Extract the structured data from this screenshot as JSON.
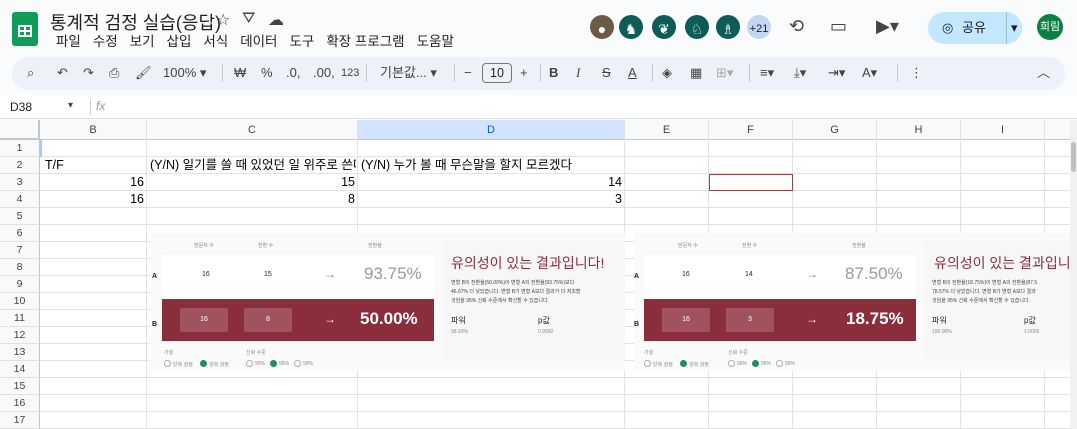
{
  "doc": {
    "title": "통계적 검정 실습(응답)"
  },
  "menu": [
    "파일",
    "수정",
    "보기",
    "삽입",
    "서식",
    "데이터",
    "도구",
    "확장 프로그램",
    "도움말"
  ],
  "collab": {
    "more": "+21"
  },
  "share": {
    "label": "공유"
  },
  "user": {
    "initials": "희림"
  },
  "toolbar": {
    "zoom": "100%",
    "currency": "₩",
    "percent": "%",
    "dec_less": ".0,",
    "dec_more": ".00,",
    "numfmt": "123",
    "font": "기본값...",
    "fontsize": "10"
  },
  "formula": {
    "cellref": "D38",
    "fx": "fx"
  },
  "columns": [
    "B",
    "C",
    "D",
    "E",
    "F",
    "G",
    "H",
    "I"
  ],
  "rows": [
    "1",
    "2",
    "3",
    "4",
    "5",
    "6",
    "7",
    "8",
    "9",
    "10",
    "11",
    "12",
    "13",
    "14",
    "15",
    "16",
    "17"
  ],
  "cells": {
    "b2": "T/F",
    "c2": "(Y/N) 일기를 쓸 때 있었던 일 위주로 쓴다",
    "d2": "(Y/N) 누가 볼 때 무슨말을 할지 모르겠다",
    "b3": "16",
    "c3": "15",
    "d3": "14",
    "b4": "16",
    "c4": "8",
    "d4": "3"
  },
  "panels": [
    {
      "hdr1": "방문자 수",
      "hdr2": "전환 수",
      "hdr3": "전환율",
      "a_label": "A",
      "a_v": "16",
      "a_c": "15",
      "a_rate": "93.75%",
      "b_label": "B",
      "b_v": "16",
      "b_c": "8",
      "b_rate": "50.00%",
      "arrow": "→",
      "opt1": "가설",
      "opt2": "신뢰 수준",
      "o1": "단측 검정",
      "o2": "양측 검정",
      "p1": "90%",
      "p2": "95%",
      "p3": "99%",
      "result": "유의성이 있는 결과입니다!",
      "desc1": "변형 B의 전환율(50.00%)이 변형 A의 전환율(93.75%)보다",
      "desc2": "46.67% 더 낮았습니다. 변형 B가 변형 A보다 결과가 더 저조할",
      "desc3": "것임을 95% 신뢰 수준에서 확신할 수 있습니다.",
      "power_label": "파워",
      "power": "98.93%",
      "p_label": "p값",
      "p": "0.9992"
    },
    {
      "hdr1": "방문자 수",
      "hdr2": "전환 수",
      "hdr3": "전환율",
      "a_label": "A",
      "a_v": "16",
      "a_c": "14",
      "a_rate": "87.50%",
      "b_label": "B",
      "b_v": "16",
      "b_c": "3",
      "b_rate": "18.75%",
      "arrow": "→",
      "opt1": "가설",
      "opt2": "신뢰 수준",
      "o1": "단측 검정",
      "o2": "양측 검정",
      "p1": "90%",
      "p2": "95%",
      "p3": "99%",
      "result": "유의성이 있는 결과입니",
      "desc1": "변형 B의 전환율(18.75%)이 변형 A의 전환율(87.5",
      "desc2": "78.57% 더 낮았습니다. 변형 B가 변형 A보다 결과",
      "desc3": "것임을 95% 신뢰 수준에서 확신할 수 있습니다.",
      "power_label": "파워",
      "power": "100.00%",
      "p_label": "p값",
      "p": "1.0000"
    }
  ]
}
